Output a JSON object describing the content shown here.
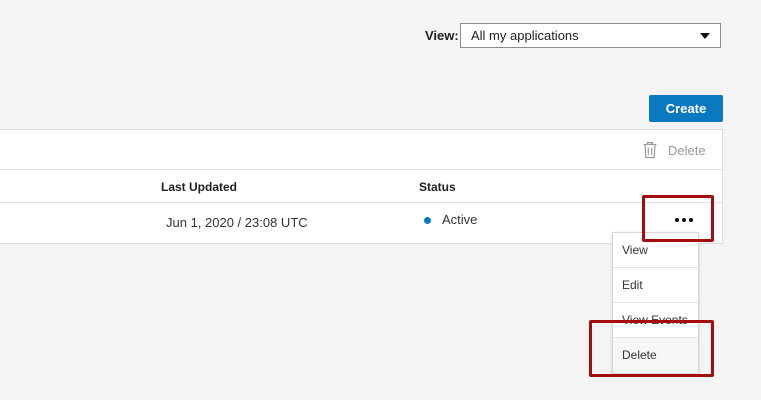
{
  "filter": {
    "label": "View:",
    "selected": "All my applications"
  },
  "toolbar": {
    "create_label": "Create",
    "delete_label": "Delete"
  },
  "table": {
    "columns": [
      "Last Updated",
      "Status"
    ],
    "rows": [
      {
        "last_updated": "Jun 1, 2020 / 23:08 UTC",
        "status": "Active"
      }
    ]
  },
  "row_menu": {
    "items": [
      "View",
      "Edit",
      "View Events",
      "Delete"
    ]
  },
  "icons": {
    "toolbar_delete": "trash-icon",
    "row_actions": "more-horizontal-icon",
    "select": "caret-down-icon"
  },
  "colors": {
    "primary": "#0a79bf",
    "status_active": "#0a79bf",
    "highlight": "#a30d0d",
    "background": "#f4f4f4"
  }
}
